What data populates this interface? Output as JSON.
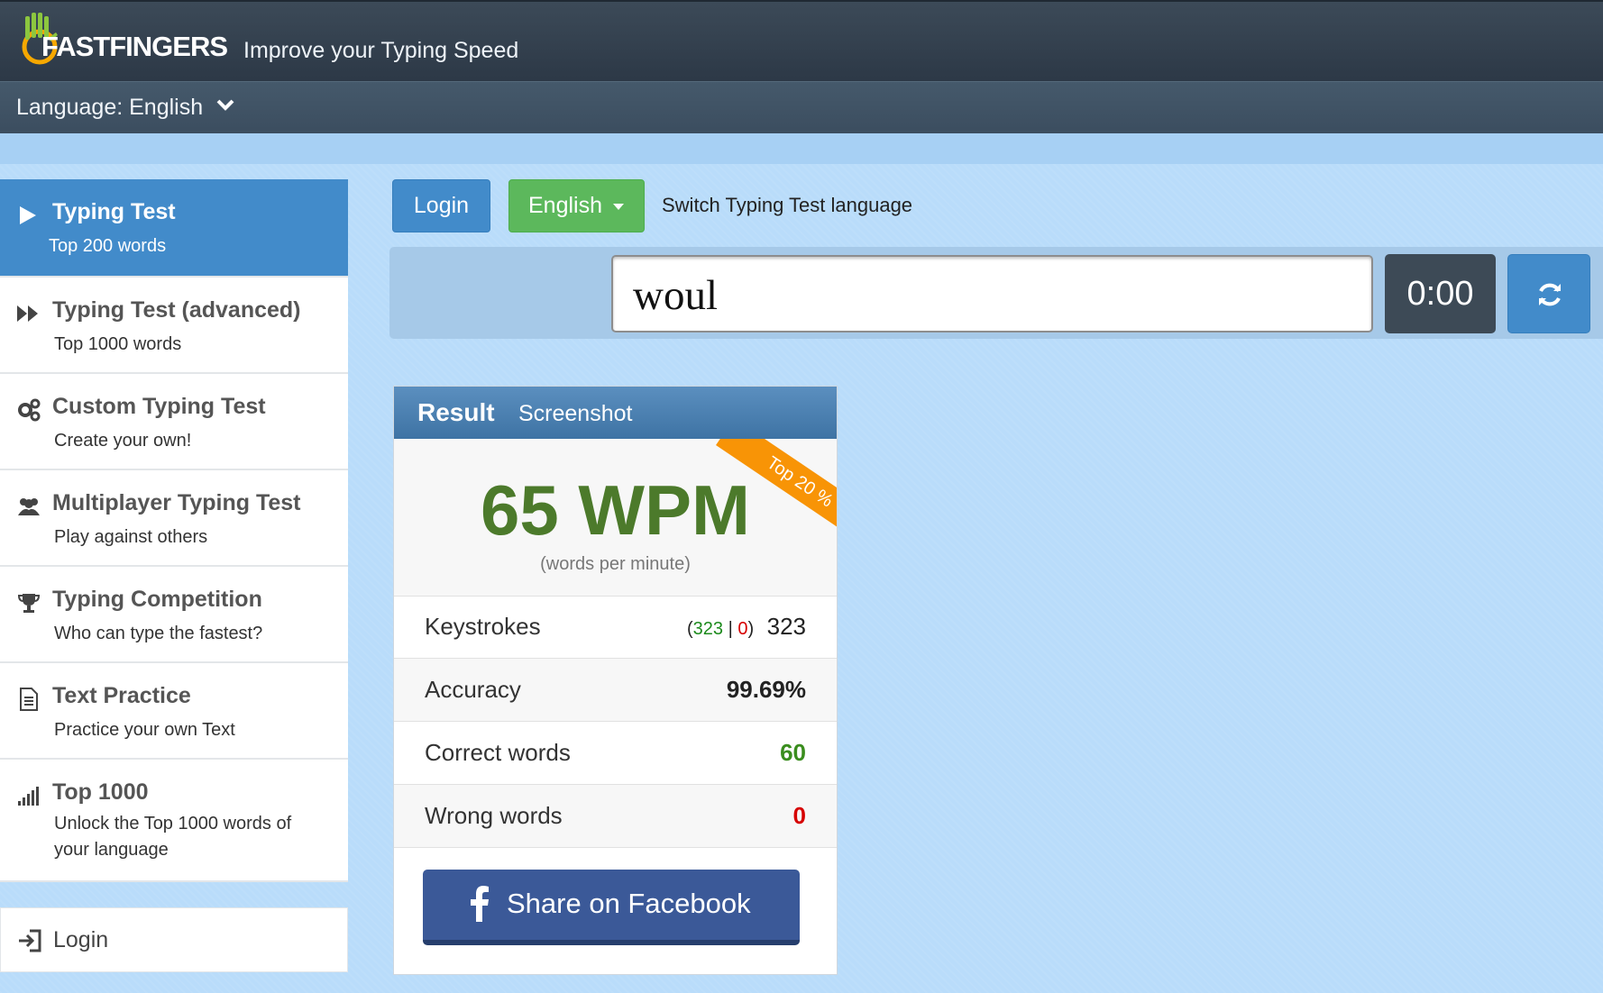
{
  "header": {
    "logo_brand": "FASTFINGERS",
    "tagline": "Improve your Typing Speed",
    "language_selector": "Language: English"
  },
  "sidebar": {
    "items": [
      {
        "title": "Typing Test",
        "sub": "Top 200 words",
        "icon": "play-icon",
        "active": true
      },
      {
        "title": "Typing Test (advanced)",
        "sub": "Top 1000 words",
        "icon": "fast-forward-icon"
      },
      {
        "title": "Custom Typing Test",
        "sub": "Create your own!",
        "icon": "gears-icon"
      },
      {
        "title": "Multiplayer Typing Test",
        "sub": "Play against others",
        "icon": "users-icon"
      },
      {
        "title": "Typing Competition",
        "sub": "Who can type the fastest?",
        "icon": "trophy-icon"
      },
      {
        "title": "Text Practice",
        "sub": "Practice your own Text",
        "icon": "document-icon"
      },
      {
        "title": "Top 1000",
        "sub": "Unlock the Top 1000 words of your language",
        "icon": "signal-bars-icon"
      }
    ],
    "login": "Login"
  },
  "controls": {
    "login_button": "Login",
    "language_button": "English",
    "switch_label": "Switch Typing Test language",
    "input_value": "woul",
    "timer": "0:00"
  },
  "result": {
    "title": "Result",
    "screenshot_tab": "Screenshot",
    "wpm": "65 WPM",
    "wpm_sub": "(words per minute)",
    "ribbon": "Top 20 %",
    "keystrokes": {
      "label": "Keystrokes",
      "correct": "323",
      "wrong": "0",
      "total": "323"
    },
    "accuracy": {
      "label": "Accuracy",
      "value": "99.69%"
    },
    "correct_words": {
      "label": "Correct words",
      "value": "60"
    },
    "wrong_words": {
      "label": "Wrong words",
      "value": "0"
    },
    "share": "Share on Facebook"
  },
  "colors": {
    "primary": "#428bca",
    "success": "#5cb85c",
    "wpm_green": "#4c7a2b",
    "ribbon_orange": "#f89406",
    "facebook": "#3b5998"
  }
}
